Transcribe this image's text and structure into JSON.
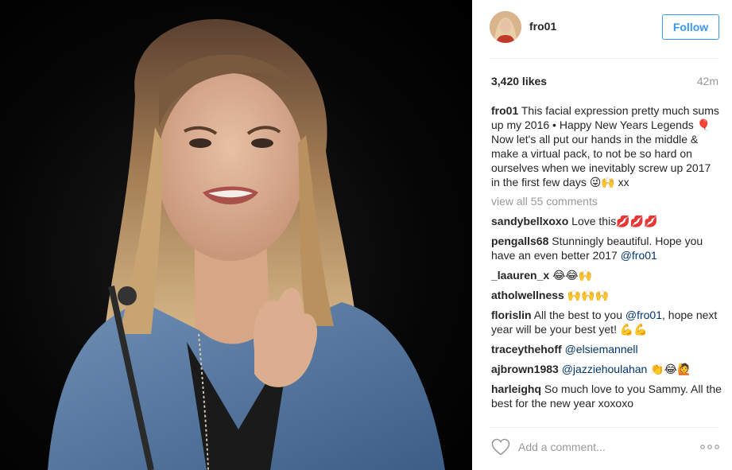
{
  "post": {
    "username": "fro01",
    "follow_label": "Follow",
    "likes": "3,420 likes",
    "time": "42m",
    "caption": {
      "username": "fro01",
      "text": "This facial expression pretty much sums up my 2016 • Happy New Years Legends 🎈 Now let's all put our hands in the middle & make a virtual pack, to not be so hard on ourselves when we inevitably screw up 2017 in the first few days 😜🙌 xx"
    },
    "view_all": "view all 55 comments",
    "comments": [
      {
        "user": "sandybellxoxo",
        "text": "Love this💋💋💋"
      },
      {
        "user": "pengalls68",
        "text": "Stunningly beautiful. Hope you have an even better 2017 ",
        "mention": "@fro01",
        "after": ""
      },
      {
        "user": "_laauren_x",
        "text": "😂😂🙌"
      },
      {
        "user": "atholwellness",
        "text": "🙌🙌🙌"
      },
      {
        "user": "florislin",
        "text": "All the best to you ",
        "mention": "@fro01",
        "after": ", hope next year will be your best yet! 💪💪"
      },
      {
        "user": "traceythehoff",
        "text": "",
        "mention": "@elsiemannell",
        "after": ""
      },
      {
        "user": "ajbrown1983",
        "text": "",
        "mention": "@jazziehoulahan",
        "after": " 👏😂🙋"
      },
      {
        "user": "harleighq",
        "text": "So much love to you Sammy. All the best for the new year xoxoxo",
        "mention": "",
        "after": ""
      }
    ],
    "add_comment_placeholder": "Add a comment...",
    "icons": {
      "like": "heart-outline-icon",
      "more": "more-dots-icon"
    },
    "colors": {
      "accent": "#3897f0",
      "mention": "#003569",
      "muted": "#999999"
    }
  }
}
